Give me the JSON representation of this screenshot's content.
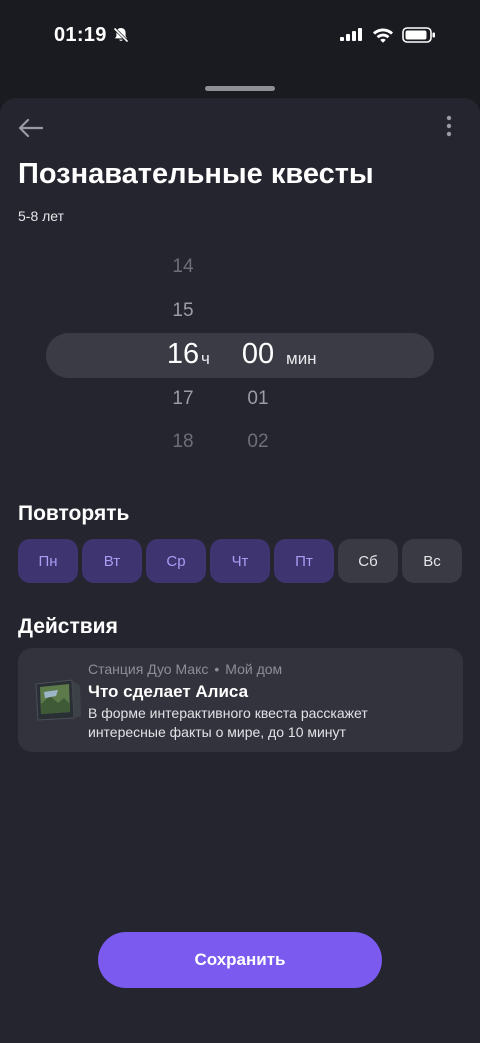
{
  "status_bar": {
    "time": "01:19",
    "icons": [
      "bell-slash-icon",
      "cellular-signal-icon",
      "wifi-icon",
      "battery-icon"
    ]
  },
  "header": {
    "back_icon": "arrow-left-icon",
    "more_icon": "more-vertical-icon",
    "title": "Познавательные квесты",
    "subtitle": "5-8 лет"
  },
  "time_picker": {
    "hours": [
      "14",
      "15",
      "16",
      "17",
      "18"
    ],
    "minutes": [
      "00",
      "01",
      "02"
    ],
    "selected_hour": "16",
    "selected_minute": "00",
    "hour_unit": "ч",
    "minute_unit": "мин"
  },
  "repeat": {
    "title": "Повторять",
    "days": [
      {
        "label": "Пн",
        "active": true
      },
      {
        "label": "Вт",
        "active": true
      },
      {
        "label": "Ср",
        "active": true
      },
      {
        "label": "Чт",
        "active": true
      },
      {
        "label": "Пт",
        "active": true
      },
      {
        "label": "Сб",
        "active": false
      },
      {
        "label": "Вс",
        "active": false
      }
    ]
  },
  "actions": {
    "title": "Действия",
    "card": {
      "device": "Станция Дуо Макс",
      "separator": "•",
      "location": "Мой дом",
      "title": "Что сделает Алиса",
      "description": "В форме интерактивного квеста расскажет интересные факты о мире, до 10 минут",
      "icon": "smart-display-icon"
    }
  },
  "footer": {
    "save_label": "Сохранить"
  },
  "colors": {
    "background": "#1a1a21",
    "sheet": "#25252f",
    "accent": "#7b5af0",
    "day_active_bg": "#3d3470",
    "day_active_text": "#a99cf2"
  }
}
